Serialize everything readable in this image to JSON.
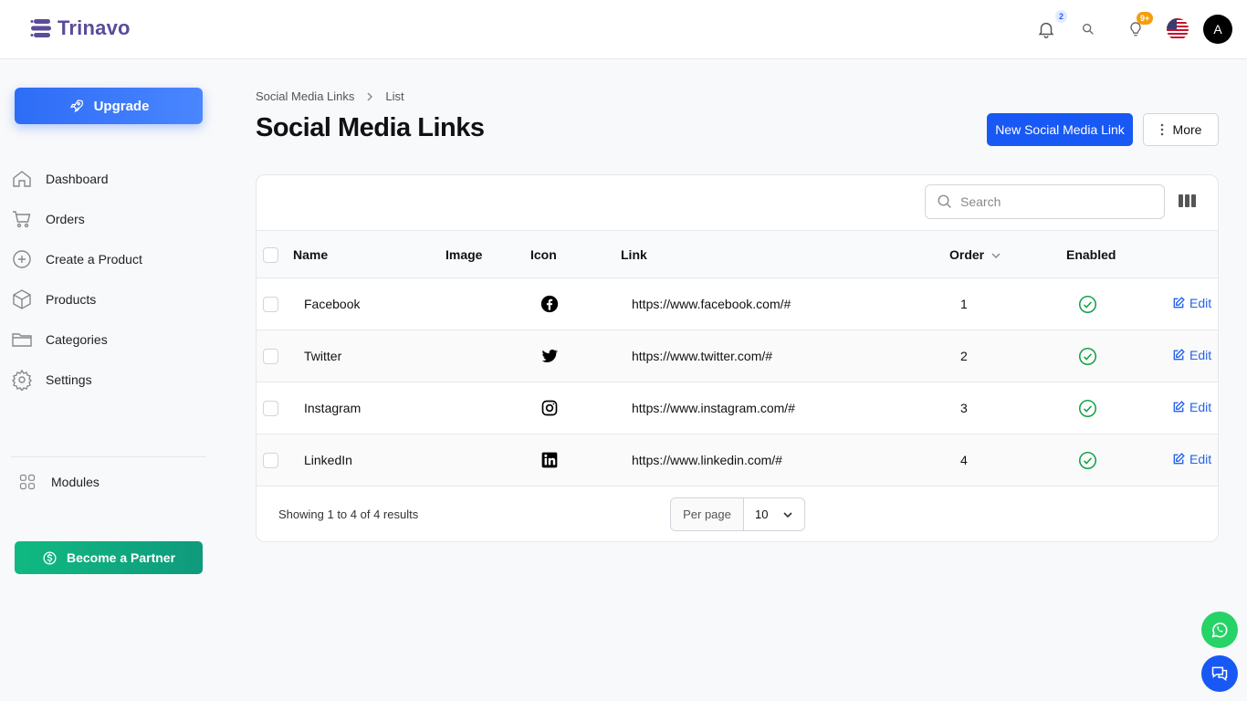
{
  "brand": {
    "name": "Trinavo"
  },
  "header": {
    "notifications_badge": "2",
    "tips_badge": "9+",
    "avatar_letter": "A",
    "icons": [
      "bell-icon",
      "search-icon",
      "lightbulb-icon",
      "us-flag-icon"
    ]
  },
  "sidebar": {
    "upgrade_label": "Upgrade",
    "items": [
      {
        "label": "Dashboard",
        "icon": "home-icon"
      },
      {
        "label": "Orders",
        "icon": "cart-icon"
      },
      {
        "label": "Create a Product",
        "icon": "plus-circle-icon"
      },
      {
        "label": "Products",
        "icon": "box-icon"
      },
      {
        "label": "Categories",
        "icon": "folder-icon"
      },
      {
        "label": "Settings",
        "icon": "gear-icon"
      }
    ],
    "modules_label": "Modules",
    "partner_label": "Become a Partner"
  },
  "breadcrumb": {
    "parent": "Social Media Links",
    "current": "List"
  },
  "page": {
    "title": "Social Media Links",
    "new_button": "New Social Media Link",
    "more_button": "More"
  },
  "table": {
    "search_placeholder": "Search",
    "columns": {
      "name": "Name",
      "image": "Image",
      "icon": "Icon",
      "link": "Link",
      "order": "Order",
      "enabled": "Enabled"
    },
    "rows": [
      {
        "name": "Facebook",
        "icon": "facebook-icon",
        "link": "https://www.facebook.com/#",
        "order": "1",
        "enabled": true,
        "action": "Edit"
      },
      {
        "name": "Twitter",
        "icon": "twitter-icon",
        "link": "https://www.twitter.com/#",
        "order": "2",
        "enabled": true,
        "action": "Edit"
      },
      {
        "name": "Instagram",
        "icon": "instagram-icon",
        "link": "https://www.instagram.com/#",
        "order": "3",
        "enabled": true,
        "action": "Edit"
      },
      {
        "name": "LinkedIn",
        "icon": "linkedin-icon",
        "link": "https://www.linkedin.com/#",
        "order": "4",
        "enabled": true,
        "action": "Edit"
      }
    ],
    "results_text": "Showing 1 to 4 of 4 results",
    "per_page_label": "Per page",
    "per_page_value": "10"
  },
  "colors": {
    "primary": "#1858f5",
    "brand": "#5b4b9a",
    "success": "#16a34a",
    "partner": "#10b981"
  }
}
